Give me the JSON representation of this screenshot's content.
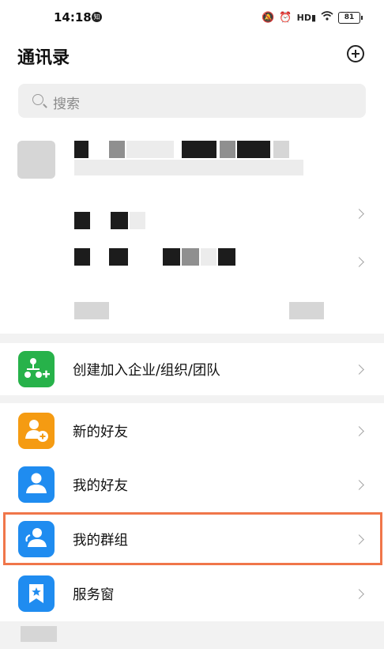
{
  "status": {
    "time": "14:18",
    "notification_badge": "知",
    "icons": [
      "mute-icon",
      "alarm-icon",
      "hd-signal-icon",
      "wifi-icon",
      "battery-icon"
    ],
    "battery": "81"
  },
  "header": {
    "title": "通讯录",
    "add_icon": "plus-circle-icon"
  },
  "search": {
    "placeholder": "搜索"
  },
  "menu": {
    "items": [
      {
        "label": "创建加入企业/组织/团队",
        "icon": "add-org-icon",
        "color": "#27b24a"
      },
      {
        "label": "新的好友",
        "icon": "add-friend-icon",
        "color": "#f59b12"
      },
      {
        "label": "我的好友",
        "icon": "person-icon",
        "color": "#1f8cf0"
      },
      {
        "label": "我的群组",
        "icon": "group-icon",
        "color": "#1f8cf0"
      },
      {
        "label": "服务窗",
        "icon": "bookmark-star-icon",
        "color": "#1f8cf0"
      }
    ]
  },
  "colors": {
    "highlight": "#f0764a"
  }
}
